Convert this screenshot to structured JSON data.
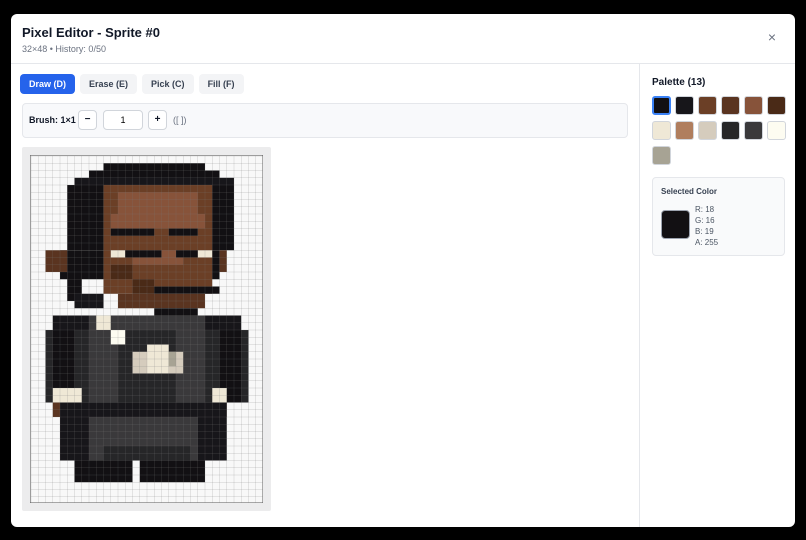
{
  "header": {
    "title": "Pixel Editor - Sprite #0",
    "subtitle": "32×48 • History: 0/50",
    "close_label": "×"
  },
  "tools": [
    {
      "label": "Draw (D)",
      "active": true
    },
    {
      "label": "Erase (E)",
      "active": false
    },
    {
      "label": "Pick (C)",
      "active": false
    },
    {
      "label": "Fill (F)",
      "active": false
    }
  ],
  "brush": {
    "label": "Brush: 1×1",
    "minus_label": "−",
    "plus_label": "+",
    "value": "1",
    "hint": "([ ])"
  },
  "palette": {
    "title": "Palette (13)",
    "colors": [
      "#121013",
      "#17161a",
      "#6b3f26",
      "#5a3420",
      "#87533a",
      "#4a2a17",
      "#efe8d6",
      "#b07e5e",
      "#d5ccbd",
      "#262628",
      "#3a393b",
      "#fdfcf1",
      "#a7a394"
    ],
    "selected_index": 0
  },
  "selected_color": {
    "title": "Selected Color",
    "hex": "#121013",
    "r": "R: 18",
    "g": "G: 16",
    "b": "B: 19",
    "a": "A: 255"
  }
}
